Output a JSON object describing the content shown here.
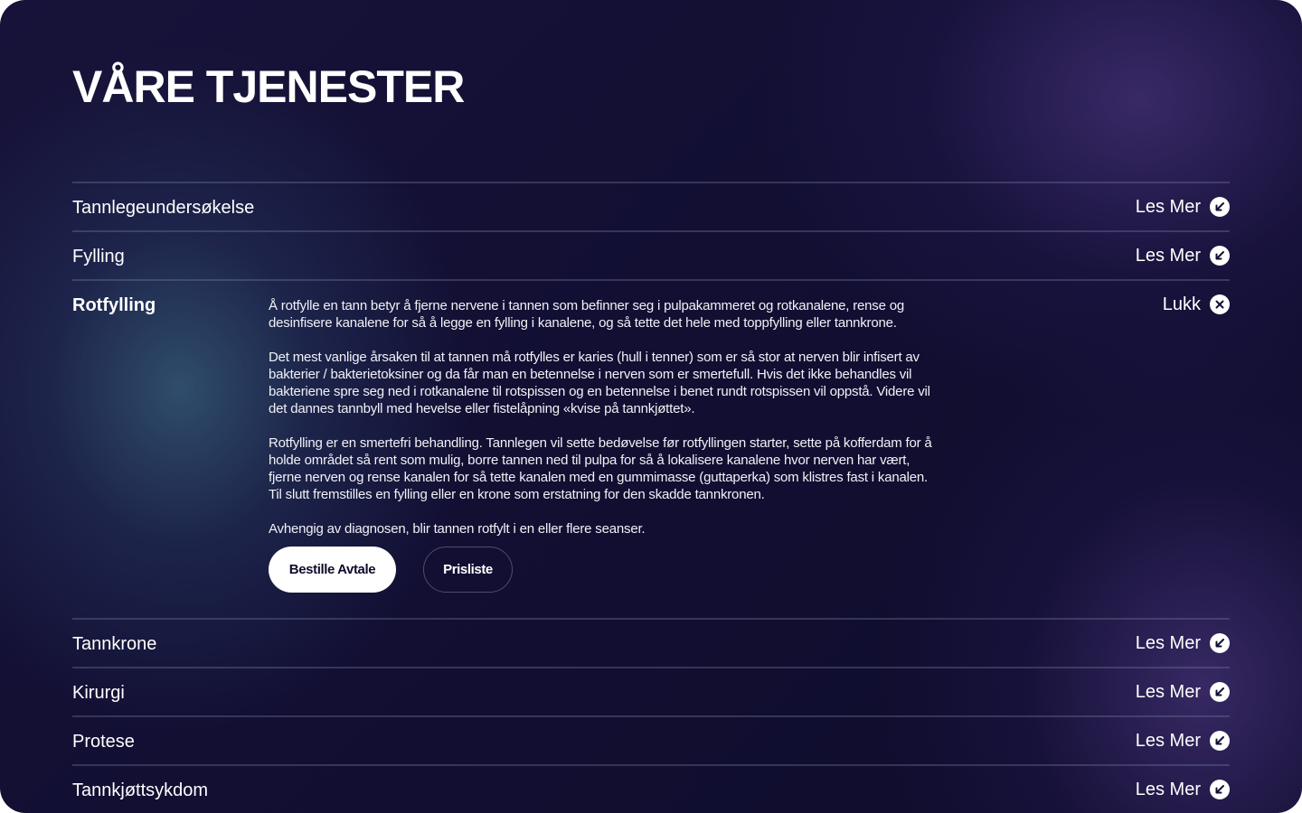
{
  "page": {
    "title": "VÅRE TJENESTER"
  },
  "colors": {
    "background_dark": "#120f33",
    "glow_teal": "#345874",
    "glow_purple": "#46327a",
    "text": "#ffffff",
    "divider": "#5a6280"
  },
  "services": [
    {
      "title": "Tannlegeundersøkelse",
      "action_label": "Les Mer",
      "action_icon": "arrow-down-left-circle-icon"
    },
    {
      "title": "Fylling",
      "action_label": "Les Mer",
      "action_icon": "arrow-down-left-circle-icon"
    },
    {
      "title": "Rotfylling",
      "action_label": "Lukk",
      "action_icon": "close-circle-icon",
      "expanded": true,
      "paragraphs": [
        "Å rotfylle en tann betyr å fjerne nervene i tannen som befinner seg i pulpakammeret og rotkanalene, rense og desinfisere kanalene for så å legge en fylling i kanalene, og så tette det hele med toppfylling eller tannkrone.",
        "Det mest vanlige årsaken til at tannen må rotfylles er karies (hull i tenner) som er så stor at nerven blir infisert av bakterier / bakterietoksiner og da får man en betennelse i nerven som er smertefull. Hvis det ikke behandles vil bakteriene spre seg ned i rotkanalene til rotspissen og en betennelse i benet rundt rotspissen vil oppstå. Videre vil det dannes tannbyll med hevelse eller fistelåpning «kvise på tannkjøttet».",
        "Rotfylling er en smertefri behandling. Tannlegen vil sette bedøvelse før rotfyllingen starter, sette på kofferdam for å holde området så rent som mulig, borre tannen ned til pulpa for så å lokalisere kanalene hvor nerven har vært, fjerne nerven og rense kanalen for så tette kanalen med en gummimasse (guttaperka) som klistres fast i kanalen. Til slutt fremstilles en fylling eller en krone som erstatning for den skadde tannkronen.",
        "Avhengig av diagnosen, blir tannen rotfylt i en eller flere seanser."
      ],
      "primary_button": "Bestille Avtale",
      "secondary_button": "Prisliste"
    },
    {
      "title": "Tannkrone",
      "action_label": "Les Mer",
      "action_icon": "arrow-down-left-circle-icon"
    },
    {
      "title": "Kirurgi",
      "action_label": "Les Mer",
      "action_icon": "arrow-down-left-circle-icon"
    },
    {
      "title": "Protese",
      "action_label": "Les Mer",
      "action_icon": "arrow-down-left-circle-icon"
    },
    {
      "title": "Tannkjøttsykdom",
      "action_label": "Les Mer",
      "action_icon": "arrow-down-left-circle-icon"
    }
  ]
}
